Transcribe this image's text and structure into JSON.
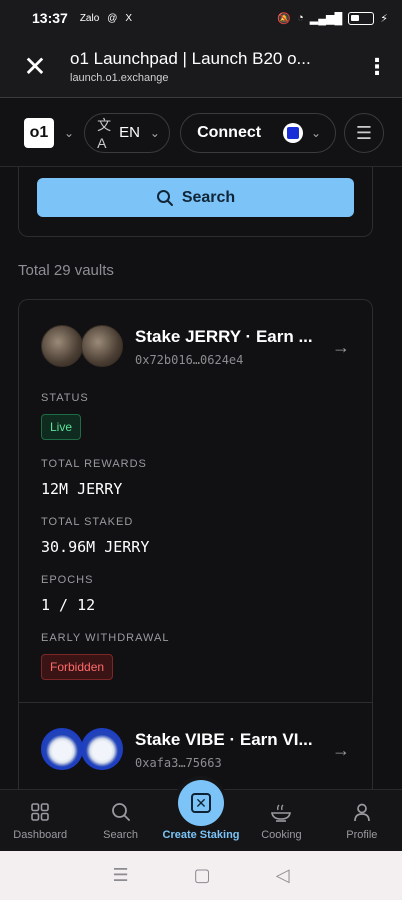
{
  "status_bar": {
    "time": "13:37",
    "apps": [
      "Zalo",
      "@",
      "X"
    ]
  },
  "browser": {
    "title": "o1 Launchpad | Launch B20 o...",
    "url": "launch.o1.exchange"
  },
  "site_nav": {
    "logo": "o1",
    "language": "EN",
    "connect_label": "Connect"
  },
  "search": {
    "button_label": "Search"
  },
  "total_vaults": "Total 29 vaults",
  "vaults": [
    {
      "name": "Stake JERRY · Earn ...",
      "address": "0x72b016…0624e4",
      "status_label": "STATUS",
      "status": "Live",
      "rewards_label": "TOTAL REWARDS",
      "rewards": "12M JERRY",
      "staked_label": "TOTAL STAKED",
      "staked": "30.96M JERRY",
      "epochs_label": "EPOCHS",
      "epochs": "1 / 12",
      "withdrawal_label": "EARLY WITHDRAWAL",
      "withdrawal": "Forbidden"
    },
    {
      "name": "Stake VIBE · Earn VI...",
      "address": "0xafa3…75663"
    }
  ],
  "bottom_nav": [
    {
      "label": "Dashboard",
      "icon": "grid-icon"
    },
    {
      "label": "Search",
      "icon": "search-icon"
    },
    {
      "label": "Create Staking",
      "icon": "create-icon"
    },
    {
      "label": "Cooking",
      "icon": "bowl-icon"
    },
    {
      "label": "Profile",
      "icon": "user-icon"
    }
  ],
  "colors": {
    "accent": "#7cc4f7",
    "live": "#5ee29a",
    "danger": "#ff6b6b",
    "background": "#111113"
  }
}
